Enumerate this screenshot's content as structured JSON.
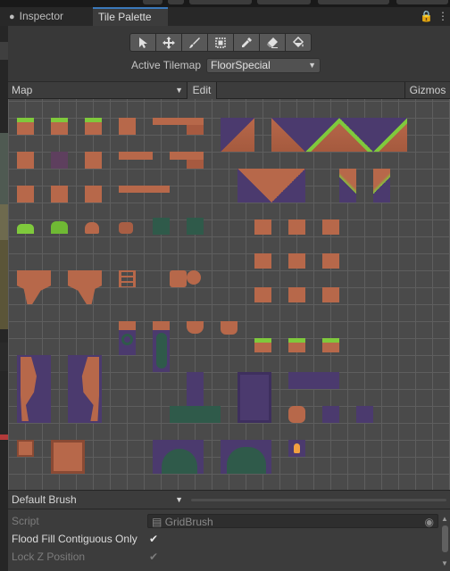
{
  "tabs": {
    "inspector": "Inspector",
    "tile_palette": "Tile Palette"
  },
  "tools": [
    "select-tool",
    "move-tool",
    "paint-brush-tool",
    "box-fill-tool",
    "picker-tool",
    "eraser-tool",
    "fill-tool"
  ],
  "active_tilemap": {
    "label": "Active Tilemap",
    "value": "FloorSpecial"
  },
  "palette_toolbar": {
    "palette": "Map",
    "edit": "Edit",
    "gizmos": "Gizmos"
  },
  "brush": {
    "selected": "Default Brush"
  },
  "properties": {
    "script_label": "Script",
    "script_value": "GridBrush",
    "flood_fill_label": "Flood Fill Contiguous Only",
    "flood_fill_checked": true,
    "lock_z_label": "Lock Z Position",
    "lock_z_checked": true
  },
  "colors": {
    "accent": "#3a79bb",
    "dirt": "#b7684a",
    "grass": "#7fc93c",
    "stone": "#4b3a6e",
    "vine": "#2f5a4a"
  }
}
